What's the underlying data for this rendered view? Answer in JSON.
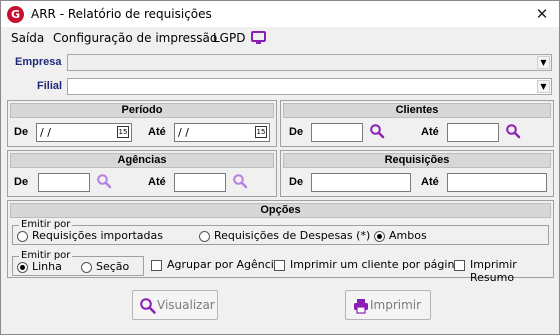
{
  "window": {
    "title": "ARR - Relatório de requisições",
    "app_icon_letter": "G",
    "close_glyph": "✕"
  },
  "menu": {
    "items": [
      "Saída",
      "Configuração de impressão",
      "LGPD"
    ]
  },
  "empresa": {
    "label": "Empresa",
    "value": ""
  },
  "filial": {
    "label": "Filial",
    "value": ""
  },
  "periodo": {
    "title": "Período",
    "de_label": "De",
    "ate_label": "Até",
    "de_value": " / /",
    "ate_value": " / /",
    "cal_glyph": "15"
  },
  "clientes": {
    "title": "Clientes",
    "de_label": "De",
    "ate_label": "Até",
    "de_value": "",
    "ate_value": ""
  },
  "agencias": {
    "title": "Agências",
    "de_label": "De",
    "ate_label": "Até",
    "de_value": "",
    "ate_value": ""
  },
  "requisicoes": {
    "title": "Requisições",
    "de_label": "De",
    "ate_label": "Até",
    "de_value": "",
    "ate_value": ""
  },
  "opcoes": {
    "title": "Opções",
    "emitir_por_1": {
      "legend": "Emitir por",
      "options": [
        "Requisições importadas",
        "Requisições de Despesas (*)",
        "Ambos"
      ],
      "selected": "Ambos"
    },
    "emitir_por_2": {
      "legend": "Emitir por",
      "options": [
        "Linha",
        "Seção"
      ],
      "selected": "Linha"
    },
    "checkboxes": [
      {
        "label": "Agrupar por Agência",
        "checked": false
      },
      {
        "label": "Imprimir um cliente por página",
        "checked": false
      },
      {
        "label": "Imprimir Resumo",
        "checked": false
      }
    ]
  },
  "buttons": {
    "visualizar": "Visualizar",
    "imprimir": "Imprimir"
  },
  "colors": {
    "label_blue": "#1f2a7a",
    "icon_purple": "#8b1fb5",
    "brand_red": "#c8102e"
  }
}
